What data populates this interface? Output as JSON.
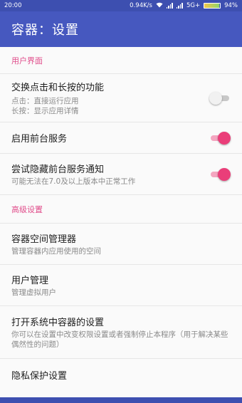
{
  "status": {
    "time": "20:00",
    "speed": "0.94K/s",
    "network": "5G+",
    "battery": "94%",
    "battery_level": 0.94
  },
  "appbar": {
    "title": "容器：设置"
  },
  "sections": {
    "ui": "用户界面",
    "advanced": "高级设置"
  },
  "items": {
    "swap_click": {
      "title": "交换点击和长按的功能",
      "sub1": "点击：直接运行应用",
      "sub2": "长按：显示应用详情",
      "switch_on": false
    },
    "foreground": {
      "title": "启用前台服务",
      "switch_on": true
    },
    "hide_notify": {
      "title": "尝试隐藏前台服务通知",
      "sub": "可能无法在7.0及以上版本中正常工作",
      "switch_on": true
    },
    "space_mgr": {
      "title": "容器空间管理器",
      "sub": "管理容器内应用使用的空间"
    },
    "user_mgr": {
      "title": "用户管理",
      "sub": "管理虚拟用户"
    },
    "sys_settings": {
      "title": "打开系统中容器的设置",
      "sub": "你可以在设置中改变权限设置或者强制停止本程序（用于解决某些偶然性的问题）"
    },
    "privacy": {
      "title": "隐私保护设置"
    }
  },
  "colors": {
    "primary": "#4658bf",
    "status_bar": "#3d4fb0",
    "accent": "#ea3e79",
    "section_header": "#e04c8a"
  }
}
